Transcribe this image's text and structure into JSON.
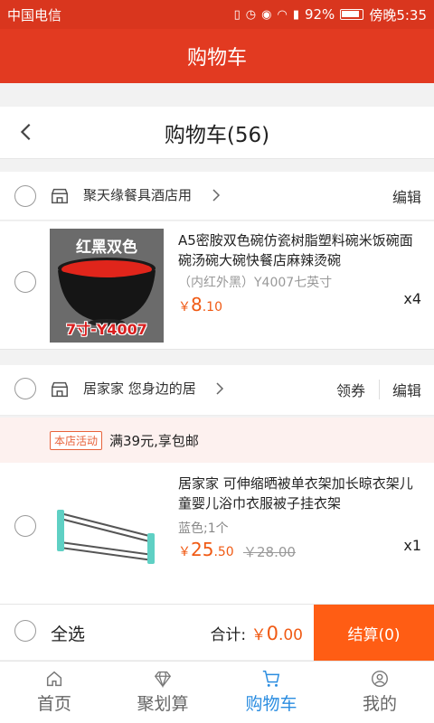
{
  "status_bar": {
    "carrier": "中国电信",
    "battery": "92%",
    "time": "傍晚5:35"
  },
  "app_bar": {
    "title": "购物车"
  },
  "header": {
    "title": "购物车(56)"
  },
  "shops": [
    {
      "name": "聚天缘餐具酒店用",
      "edit_label": "编辑",
      "items": [
        {
          "name": "A5密胺双色碗仿瓷树脂塑料碗米饭碗面碗汤碗大碗快餐店麻辣烫碗",
          "spec": "（内红外黑）Y4007七英寸",
          "price_symbol": "￥",
          "price_int": "8",
          "price_dec": ".10",
          "qty": "x4",
          "thumb_label_top": "红黑双色",
          "thumb_label_bottom": "7寸-Y4007"
        }
      ]
    },
    {
      "name": "居家家 您身边的居",
      "coupon_label": "领券",
      "edit_label": "编辑",
      "promo_tag": "本店活动",
      "promo_text": "满39元,享包邮",
      "items": [
        {
          "name": "居家家 可伸缩晒被单衣架加长晾衣架儿童婴儿浴巾衣服被子挂衣架",
          "spec": "蓝色;1个",
          "price_symbol": "￥",
          "price_int": "25",
          "price_dec": ".50",
          "original_price": "￥28.00",
          "qty": "x1"
        }
      ]
    }
  ],
  "summary": {
    "select_all_label": "全选",
    "total_label": "合计:",
    "total_symbol": "￥",
    "total_int": "0",
    "total_dec": ".00",
    "checkout_label": "结算(0)"
  },
  "tabs": [
    {
      "label": "首页",
      "icon": "home-icon"
    },
    {
      "label": "聚划算",
      "icon": "diamond-icon"
    },
    {
      "label": "购物车",
      "icon": "cart-icon",
      "active": true
    },
    {
      "label": "我的",
      "icon": "user-icon"
    }
  ],
  "colors": {
    "brand_red": "#e23a21",
    "price_orange": "#f05a14",
    "checkout_orange": "#ff5d14",
    "active_tab_blue": "#2b8de0"
  }
}
